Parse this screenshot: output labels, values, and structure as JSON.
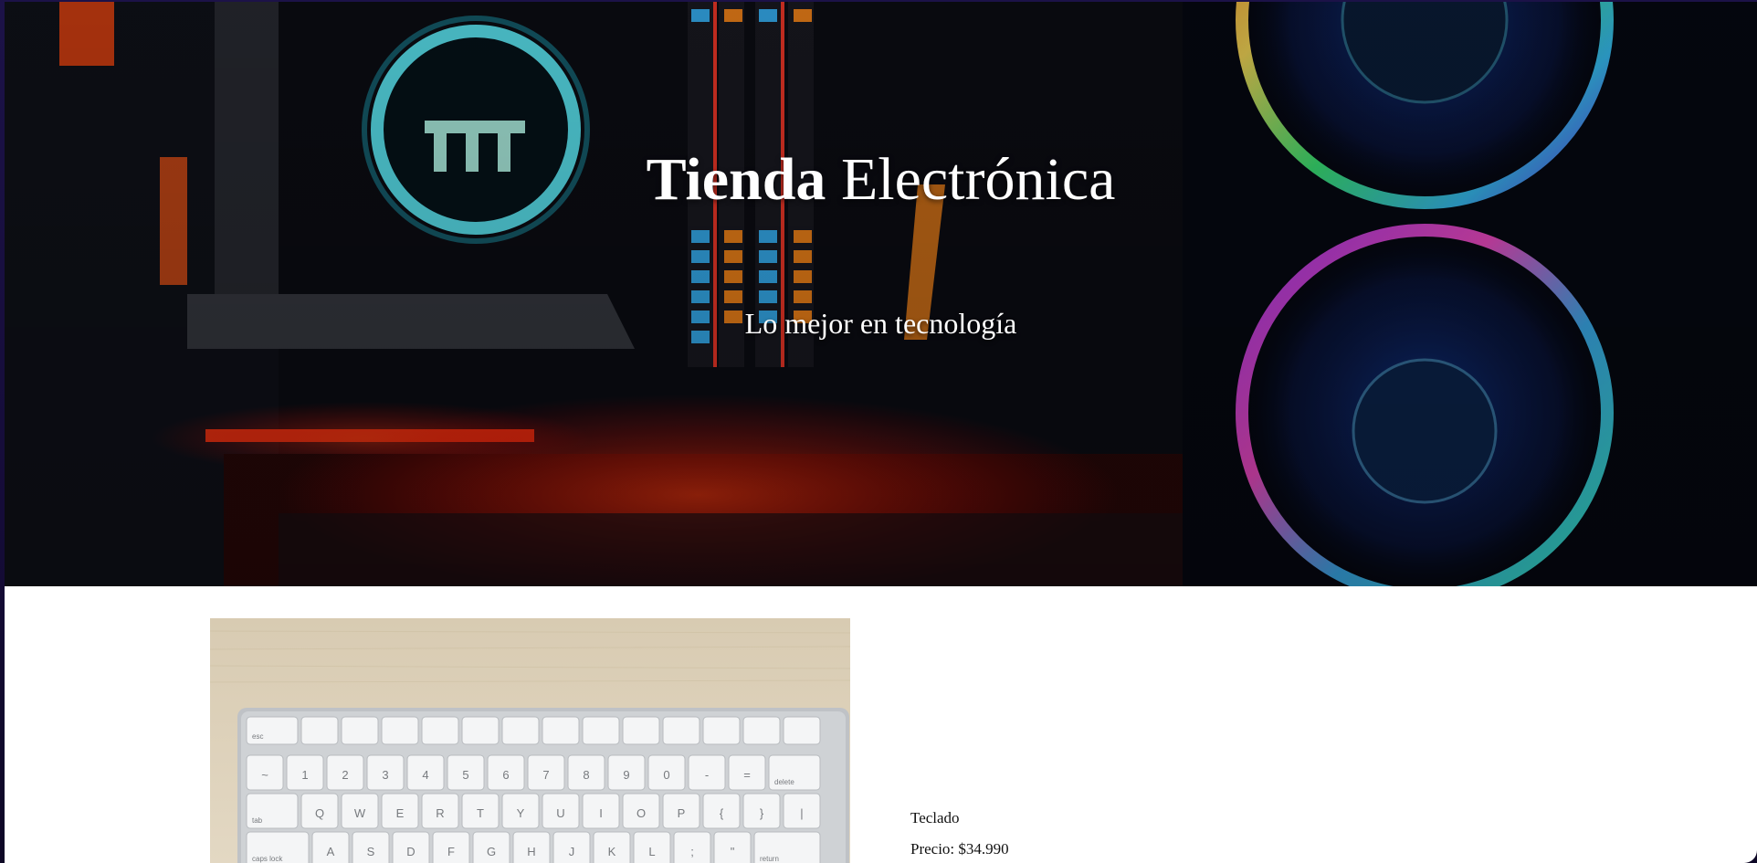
{
  "hero": {
    "title_bold": "Tienda",
    "title_rest": "Electrónica",
    "subtitle": "Lo mejor en tecnología"
  },
  "products": [
    {
      "name": "Teclado",
      "price_label": "Precio:",
      "price_value": "$34.990"
    }
  ],
  "keyboard": {
    "rows": [
      [
        "esc",
        "",
        "",
        "",
        "",
        "",
        "",
        "",
        "",
        "",
        "",
        "",
        "",
        ""
      ],
      [
        "~",
        "1",
        "2",
        "3",
        "4",
        "5",
        "6",
        "7",
        "8",
        "9",
        "0",
        "-",
        "=",
        "delete"
      ],
      [
        "tab",
        "Q",
        "W",
        "E",
        "R",
        "T",
        "Y",
        "U",
        "I",
        "O",
        "P",
        "{",
        "}",
        "|"
      ],
      [
        "caps lock",
        "A",
        "S",
        "D",
        "F",
        "G",
        "H",
        "J",
        "K",
        "L",
        ";",
        "\"",
        "return"
      ]
    ]
  },
  "colors": {
    "page_background": "#1a1040",
    "content_background": "#ffffff",
    "hero_text": "#ffffff"
  }
}
